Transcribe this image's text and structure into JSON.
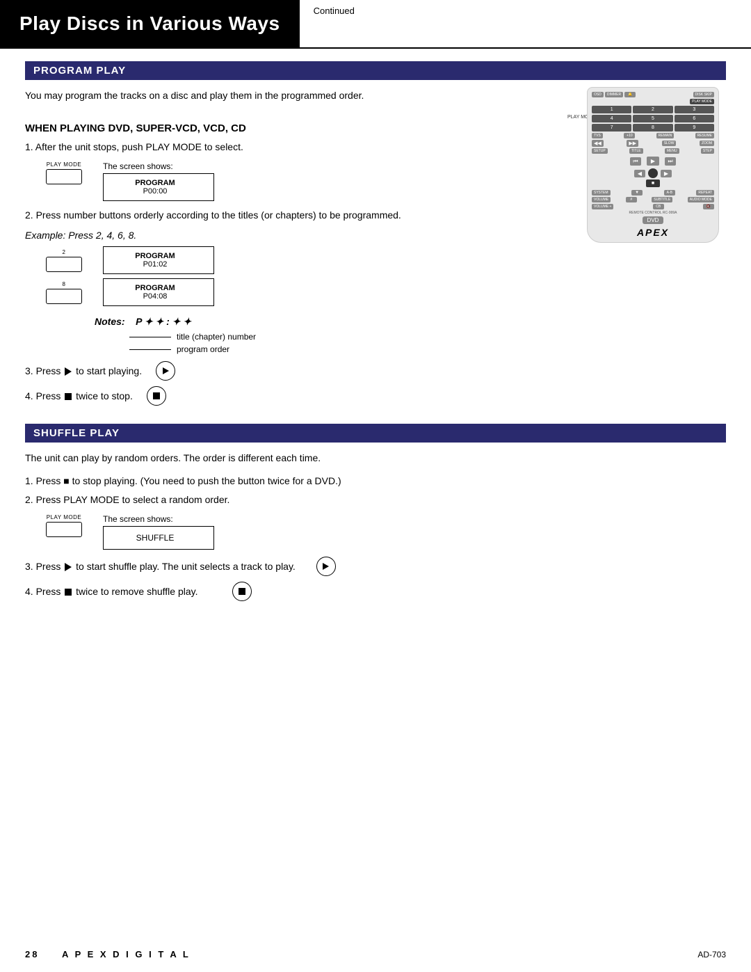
{
  "header": {
    "title": "Play Discs in Various Ways",
    "continued": "Continued"
  },
  "program_play": {
    "section_title": "PROGRAM PLAY",
    "intro": "You may program the tracks on a disc and play them in the programmed order.",
    "sub_heading": "WHEN PLAYING DVD, SUPER-VCD, VCD, CD",
    "step1": "1. After the unit stops, push PLAY MODE to select.",
    "screen_shows_label": "The screen shows:",
    "play_mode_label": "PLAY MODE",
    "program_screen_line1": "PROGRAM",
    "program_screen_line2": "P00:00",
    "step2": "2. Press number buttons orderly according to the titles (or chapters) to be programmed.",
    "example_text": "Example: Press 2, 4, 6, 8.",
    "btn_2_label": "2",
    "program_screen2_line1": "PROGRAM",
    "program_screen2_line2": "P01:02",
    "btn_8_label": "8",
    "program_screen3_line1": "PROGRAM",
    "program_screen3_line2": "P04:08",
    "notes_label": "Notes:",
    "notes_pattern": "P ✦ ✦ : ✦ ✦",
    "annotation1": "title (chapter) number",
    "annotation2": "program order",
    "step3": "3. Press ▶ to start playing.",
    "step4": "4. Press ■ twice to stop."
  },
  "shuffle_play": {
    "section_title": "SHUFFLE PLAY",
    "intro": "The unit can play by random orders.  The order is different each time.",
    "step1": "1. Press ■ to stop playing. (You need to push the button twice for a DVD.)",
    "step2": "2. Press PLAY MODE to select a random order.",
    "screen_shows_label": "The screen shows:",
    "play_mode_label": "PLAY MODE",
    "shuffle_screen_text": "SHUFFLE",
    "step3": "3. Press ▶ to start shuffle play.  The unit selects a track to play.",
    "step4": "4. Press ■ twice to remove shuffle play."
  },
  "footer": {
    "page_number": "28",
    "brand": "A  P  E  X     D  I  G  I  T  A  L",
    "model": "AD-703"
  }
}
